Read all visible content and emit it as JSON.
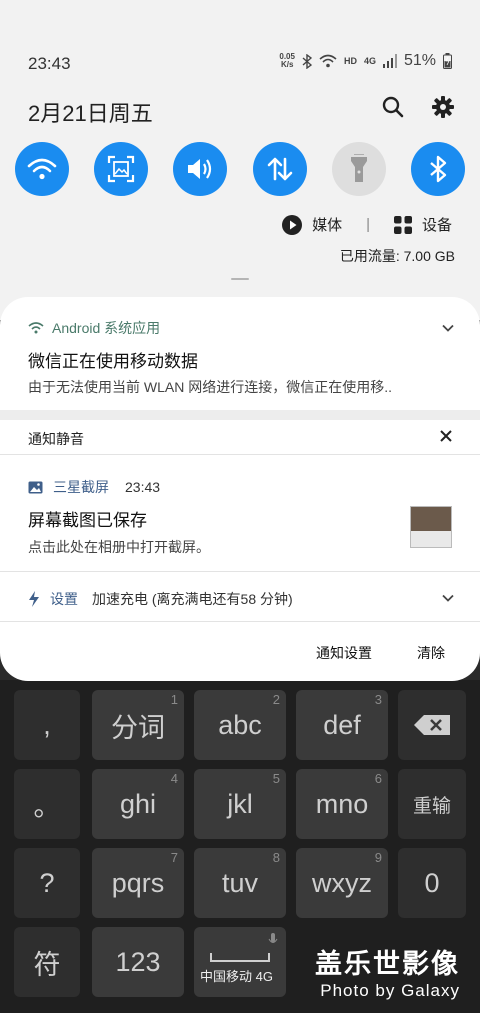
{
  "status_bar": {
    "time": "23:43",
    "net_speed_value": "0.05",
    "net_speed_unit": "K/s",
    "hd_label": "HD",
    "network_label": "4G",
    "battery": "51%"
  },
  "header": {
    "date": "2月21日周五"
  },
  "quick_settings": [
    {
      "name": "wifi",
      "state": "on"
    },
    {
      "name": "screenshot",
      "state": "on"
    },
    {
      "name": "sound",
      "state": "on"
    },
    {
      "name": "mobile-data",
      "state": "on"
    },
    {
      "name": "flashlight",
      "state": "off"
    },
    {
      "name": "bluetooth",
      "state": "on"
    }
  ],
  "media_row": {
    "media_label": "媒体",
    "devices_label": "设备"
  },
  "data_usage": "已用流量: 7.00 GB",
  "notifications": {
    "n1": {
      "app": "Android 系统应用",
      "title": "微信正在使用移动数据",
      "body": "由于无法使用当前 WLAN 网络进行连接，微信正在使用移.."
    },
    "silent_label": "通知静音",
    "n2": {
      "app": "三星截屏",
      "time": "23:43",
      "title": "屏幕截图已保存",
      "body": "点击此处在相册中打开截屏。"
    },
    "n3": {
      "app": "设置",
      "text": "加速充电 (离充满电还有58 分钟)"
    },
    "actions": {
      "settings_label": "通知设置",
      "clear_label": "清除"
    }
  },
  "keyboard": {
    "row1": [
      ",",
      "分词",
      "abc",
      "def"
    ],
    "row1_nums": [
      "",
      "1",
      "2",
      "3"
    ],
    "row2": [
      "。",
      "ghi",
      "jkl",
      "mno",
      "重输"
    ],
    "row2_nums": [
      "",
      "4",
      "5",
      "6"
    ],
    "row3": [
      "?",
      "pqrs",
      "tuv",
      "wxyz",
      "0"
    ],
    "row3_nums": [
      "",
      "7",
      "8",
      "9"
    ],
    "row4": [
      "符",
      "123"
    ]
  },
  "carrier": "中国移动 4G",
  "watermark": {
    "line1": "盖乐世影像",
    "line2": "Photo by Galaxy"
  },
  "colors": {
    "accent": "#1a8cf0",
    "panel_bg": "#f2f2f2",
    "keyboard_bg": "#1f1f1f"
  }
}
